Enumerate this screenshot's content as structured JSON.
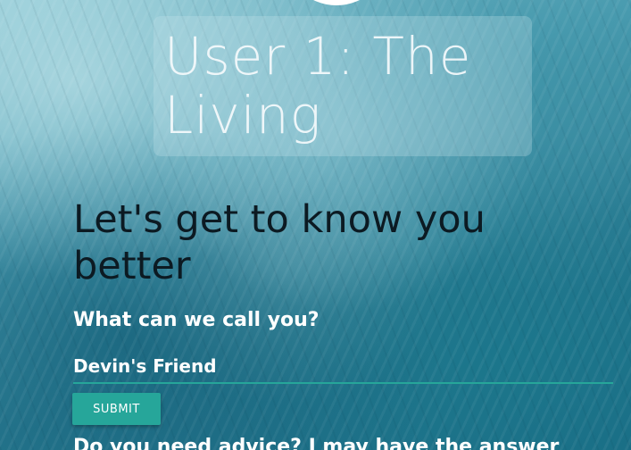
{
  "header": {
    "title": "User 1: The Living"
  },
  "intro": {
    "heading": "Let's get to know you better"
  },
  "name_form": {
    "question": "What can we call you?",
    "value": "Devin's Friend",
    "submit_label": "SUBMIT"
  },
  "advice": {
    "question": "Do you need advice? I may have the answer"
  },
  "colors": {
    "accent": "#26a69a",
    "heading_text": "#0c1a22",
    "label_text": "#ffffff"
  }
}
